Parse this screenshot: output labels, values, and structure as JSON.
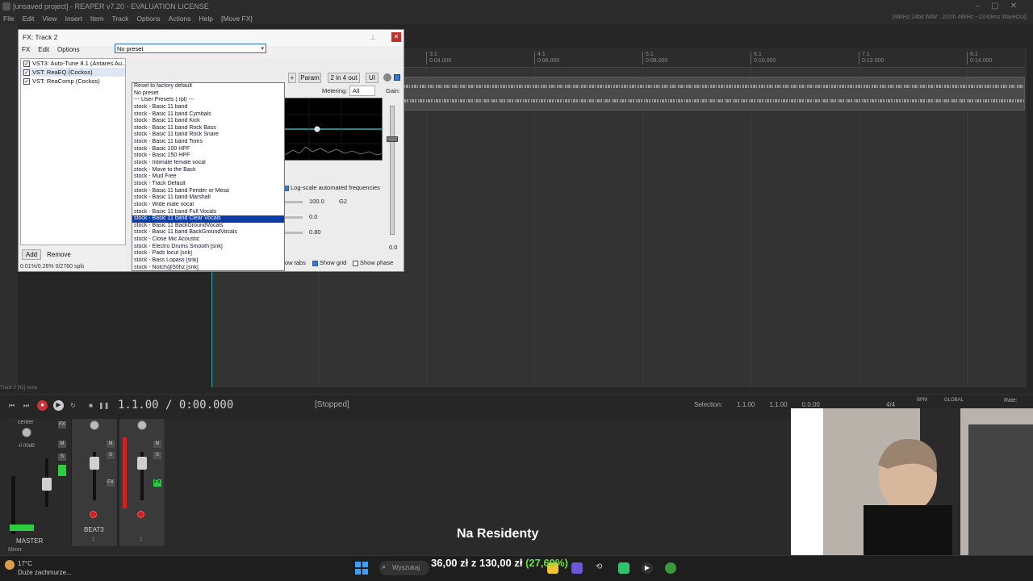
{
  "window": {
    "title": "[unsaved project] - REAPER v7.20 - EVALUATION LICENSE",
    "status_top": "[48kHz 24bit WAV : 2/2ch 48kHz ~22/43ms WaveOut]"
  },
  "menubar": [
    "File",
    "Edit",
    "View",
    "Insert",
    "Item",
    "Track",
    "Options",
    "Actions",
    "Help",
    "[Move FX]"
  ],
  "ruler": [
    {
      "bar": "3.1",
      "time": "0:04.000"
    },
    {
      "bar": "4.1",
      "time": "0:06.000"
    },
    {
      "bar": "5.1",
      "time": "0:08.000"
    },
    {
      "bar": "6.1",
      "time": "0:10.000"
    },
    {
      "bar": "7.1",
      "time": "0:12.000"
    },
    {
      "bar": "8.1",
      "time": "0:14.000"
    }
  ],
  "fx_window": {
    "title": "FX: Track 2",
    "menu": [
      "FX",
      "Edit",
      "Options"
    ],
    "chain": [
      {
        "label": "VST3: Auto-Tune 8.1 (Antares Au...",
        "checked": true
      },
      {
        "label": "VST: ReaEQ (Cockos)",
        "checked": true
      },
      {
        "label": "VST: ReaComp (Cockos)",
        "checked": true
      }
    ],
    "add_label": "Add",
    "remove_label": "Remove",
    "cpu": "0.01%/0.26% 0/2760 spls",
    "preset_value": "No preset",
    "plus_label": "+",
    "param_label": "Param",
    "io_label": "2 in 4 out",
    "ui_label": "UI",
    "metering_label": "Metering:",
    "metering_value": "All",
    "gain_label": "Gain:",
    "log_scale_label": "Log-scale automated frequencies",
    "freq_value": "100.0",
    "note_value": "G2",
    "gain_value": "0.0",
    "bw_value": "0.80",
    "gain_readout": "0.0",
    "show_tabs_label": "ow tabs",
    "show_grid_label": "Show grid",
    "show_phase_label": "Show phase"
  },
  "preset_dropdown": {
    "items": [
      "Reset to factory default",
      "No preset",
      "--- User Presets (.rpl) ---",
      "stock - Basic 11 band",
      "stock - Basic 11 band Cymbals",
      "stock - Basic 11 band Kick",
      "stock - Basic 11 band Rock Bass",
      "stock - Basic 11 band Rock Snare",
      "stock - Basic 11 band Toms",
      "stock - Basic 100 HPF",
      "stock - Basic 150 HPF",
      "stock - Intimate female vocal",
      "stock - Move to the Back",
      "stock - Mud Free",
      "stock - Track Default",
      "stock - Basic 11 band Fender or Mesa",
      "stock - Basic 11 band Marshall",
      "stock - Wide male vocal",
      "stock - Basic 11 band Full Vocals",
      "stock - Basic 11 band Clear Vocals",
      "stock - Basic 11 BackGroundVocals",
      "stock - Basic 11 band BackGroundVocals",
      "stock - Close Mic Acoustic",
      "stock - Electro Drums Smooth [snk]",
      "stock - Pads locut [snk]",
      "stock - Bass Lopass [snk]",
      "stock - Notch@50hz [snk]"
    ],
    "highlighted_index": 19
  },
  "transport": {
    "time": "1.1.00 / 0:00.000",
    "state": "[Stopped]",
    "track_info": "Track 2 [IO] none",
    "selection_label": "Selection:",
    "sel_start": "1.1.00",
    "sel_end": "1.1.00",
    "sel_len": "0.0.00",
    "timesig": "4/4",
    "bpm_label": "BPM",
    "global_label": "GLOBAL",
    "rate_label": "Rate:"
  },
  "mixer": {
    "master_label": "MASTER",
    "center_label": "center",
    "master_db": "-0.00dB",
    "track_name": "BEAT3",
    "mixer_tab": "Mixer",
    "strip_numbers": [
      "1",
      "2"
    ]
  },
  "overlay": {
    "subtitle": "Na Residenty",
    "donation_amount": "36,00 zł z 130,00 zł",
    "donation_pct": "(27,69%)"
  },
  "taskbar": {
    "temp": "17°C",
    "weather": "Duże zachmurze...",
    "search_placeholder": "Wyszukaj"
  },
  "colors": {
    "highlight": "#0a3ea6",
    "eq_line": "#2fb8b8",
    "meter_green": "#2ecc40",
    "rec_red": "#cc2222"
  }
}
